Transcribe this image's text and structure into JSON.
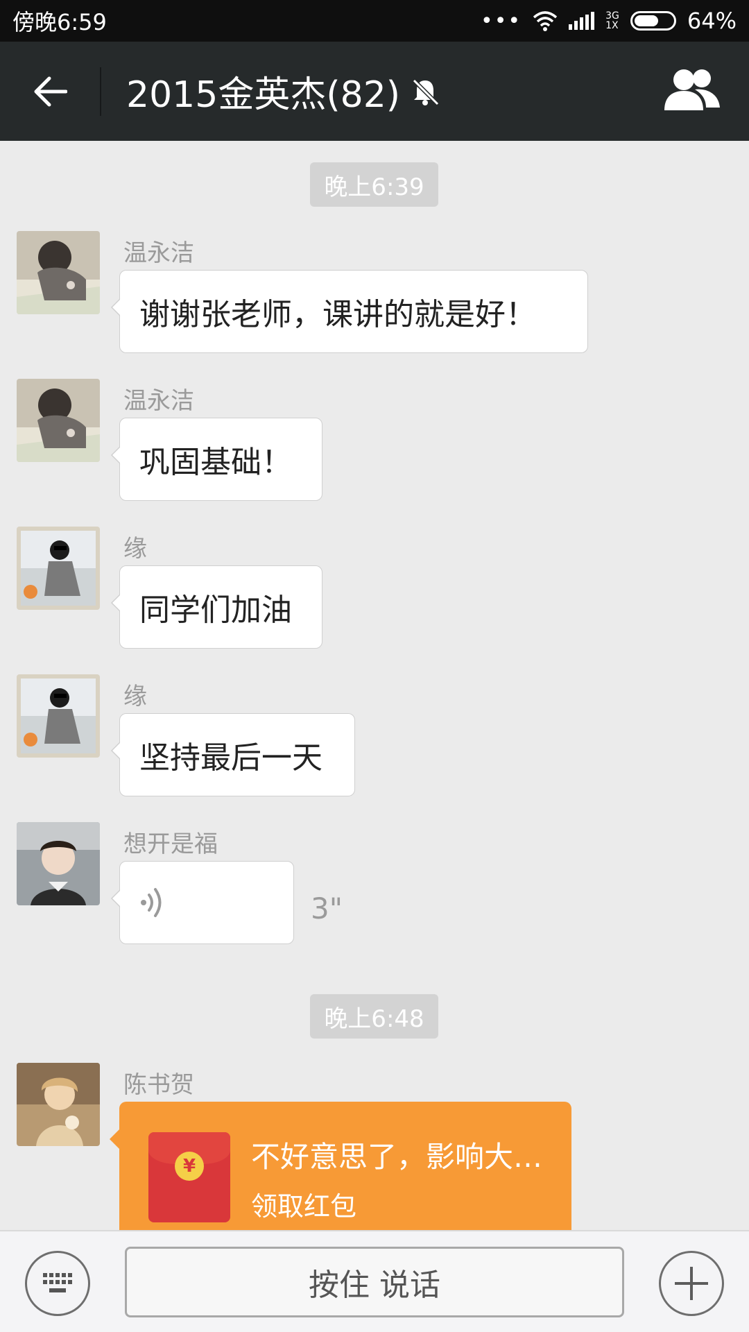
{
  "status_bar": {
    "time": "傍晚6:59",
    "dots": "•••",
    "network_top": "3G",
    "network_bottom": "1X",
    "battery": "64%"
  },
  "header": {
    "back_icon": "arrow-left-icon",
    "title": "2015金英杰(82)",
    "mute_icon": "bell-off-icon",
    "members_icon": "group-members-icon"
  },
  "chat": {
    "timestamps": [
      "晚上6:39",
      "晚上6:48"
    ],
    "messages": [
      {
        "sender": "温永洁",
        "text": "谢谢张老师，课讲的就是好！",
        "type": "text"
      },
      {
        "sender": "温永洁",
        "text": "巩固基础！",
        "type": "text"
      },
      {
        "sender": "缘",
        "text": "同学们加油",
        "type": "text"
      },
      {
        "sender": "缘",
        "text": "坚持最后一天",
        "type": "text"
      },
      {
        "sender": "想开是福",
        "type": "voice",
        "duration": "3\""
      },
      {
        "sender": "陈书贺",
        "type": "red_packet",
        "title": "不好意思了，影响大…",
        "action": "领取红包",
        "coin_symbol": "¥"
      }
    ]
  },
  "input_bar": {
    "keyboard_icon": "keyboard-icon",
    "hold_to_talk": "按住 说话",
    "plus_icon": "plus-icon"
  },
  "colors": {
    "status_bar_bg": "#0f0f0f",
    "header_bg": "#262a2b",
    "chat_bg": "#ebebeb",
    "red_packet": "#f79a36"
  }
}
